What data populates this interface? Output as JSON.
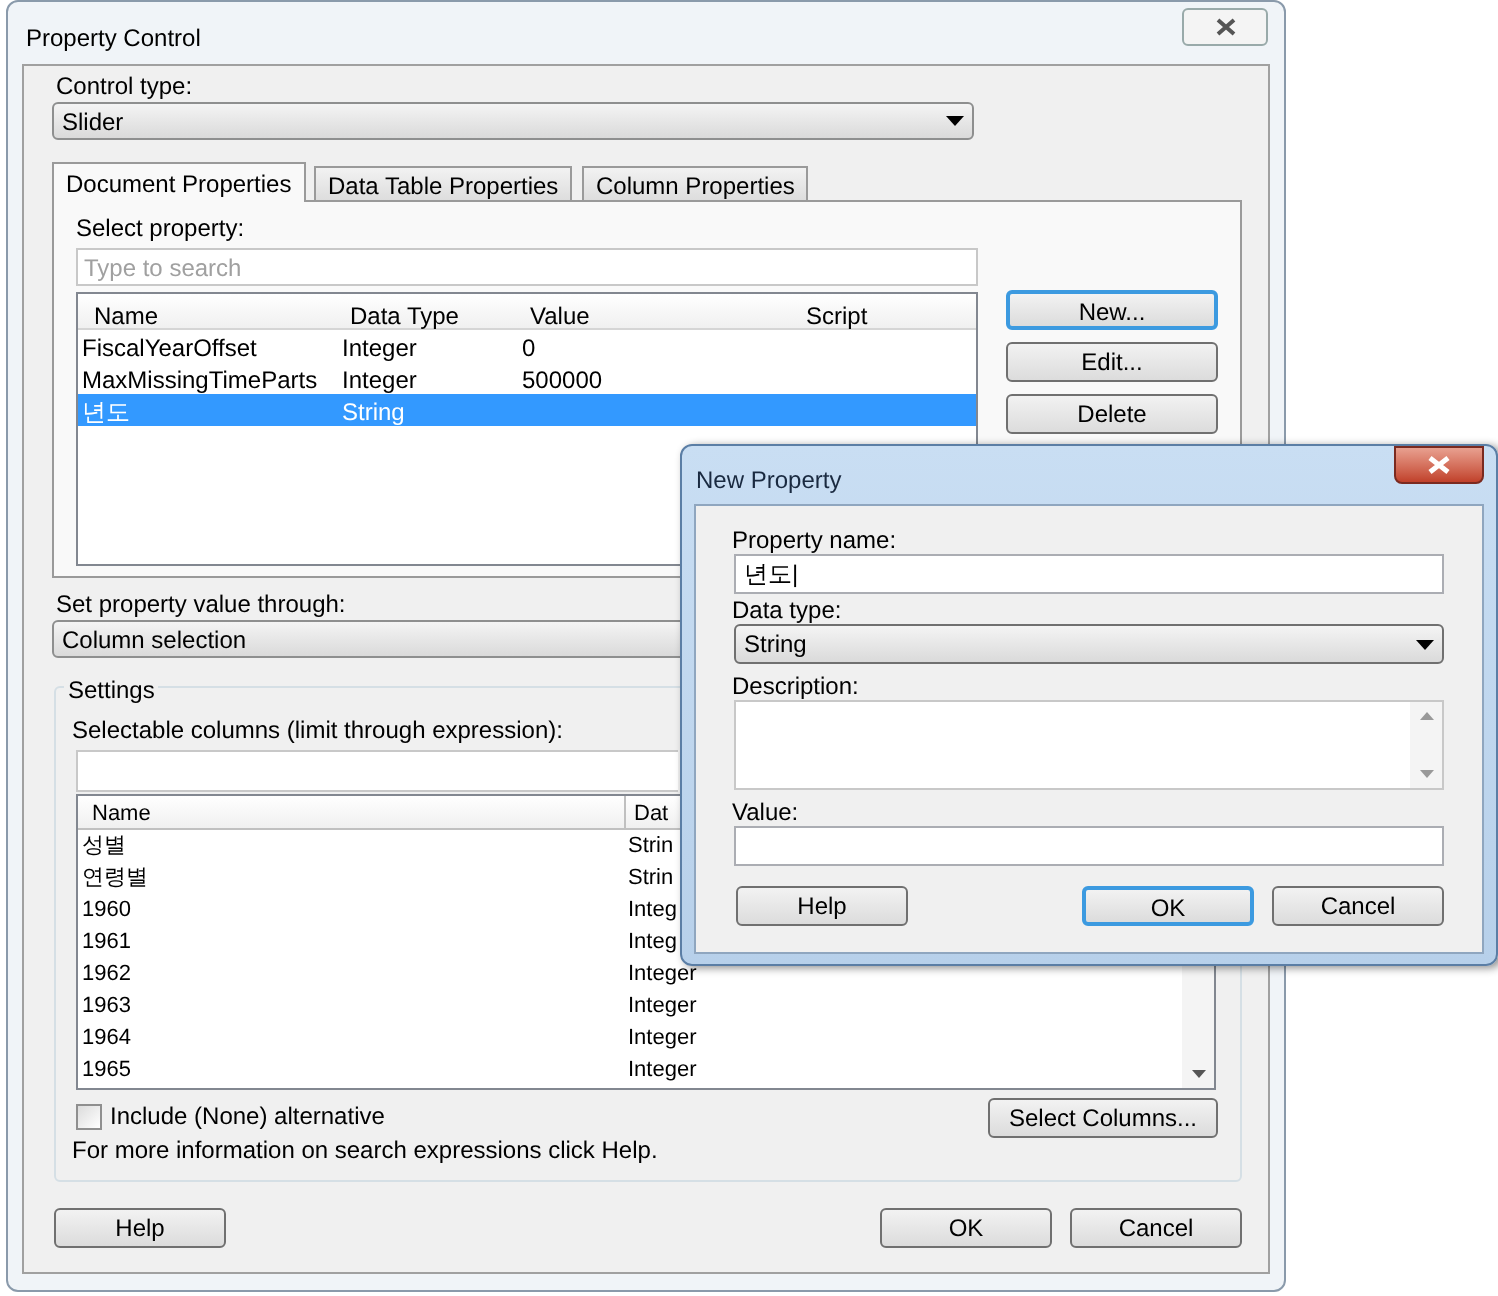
{
  "main_window": {
    "title": "Property Control",
    "control_type": {
      "label": "Control type:",
      "value": "Slider"
    },
    "tabs": [
      {
        "label": "Document Properties",
        "selected": true
      },
      {
        "label": "Data Table Properties",
        "selected": false
      },
      {
        "label": "Column Properties",
        "selected": false
      }
    ],
    "select_property": {
      "label": "Select property:"
    },
    "search": {
      "placeholder": "Type to search"
    },
    "property_table": {
      "columns": [
        "Name",
        "Data Type",
        "Value",
        "Script"
      ],
      "rows": [
        {
          "cells": [
            "FiscalYearOffset",
            "Integer",
            "0"
          ],
          "selected": false
        },
        {
          "cells": [
            "MaxMissingTimeParts",
            "Integer",
            "500000"
          ],
          "selected": false
        },
        {
          "cells": [
            "년도",
            "String"
          ],
          "selected": true
        }
      ]
    },
    "side_buttons": [
      {
        "label": "New...",
        "default": true
      },
      {
        "label": "Edit...",
        "default": false
      },
      {
        "label": "Delete",
        "default": false
      }
    ],
    "set_value": {
      "label": "Set property value through:",
      "value": "Column selection"
    },
    "settings": {
      "title": "Settings",
      "label": "Selectable columns (limit through expression):",
      "columns": [
        "Name",
        "Dat"
      ],
      "rows": [
        [
          "성별",
          "Strin"
        ],
        [
          "연령별",
          "Strin"
        ],
        [
          "1960",
          "Integ"
        ],
        [
          "1961",
          "Integ"
        ],
        [
          "1962",
          "Integer"
        ],
        [
          "1963",
          "Integer"
        ],
        [
          "1964",
          "Integer"
        ],
        [
          "1965",
          "Integer"
        ]
      ]
    },
    "include_none": {
      "label": "Include (None) alternative",
      "checked": false
    },
    "info": "For more information on search expressions click Help.",
    "select_columns_button": "Select Columns...",
    "footer_buttons": [
      {
        "label": "Help",
        "default": false
      },
      {
        "label": "OK",
        "default": false
      },
      {
        "label": "Cancel",
        "default": false
      }
    ]
  },
  "new_property_dialog": {
    "title": "New Property",
    "fields": [
      {
        "kind": "text",
        "label": "Property name:",
        "value": "년도|"
      },
      {
        "kind": "combo",
        "label": "Data type:",
        "value": "String"
      },
      {
        "kind": "textarea",
        "label": "Description:"
      },
      {
        "kind": "text",
        "label": "Value:"
      }
    ],
    "buttons": [
      {
        "label": "Help",
        "default": false
      },
      {
        "label": "OK",
        "default": true
      },
      {
        "label": "Cancel",
        "default": false
      }
    ]
  }
}
